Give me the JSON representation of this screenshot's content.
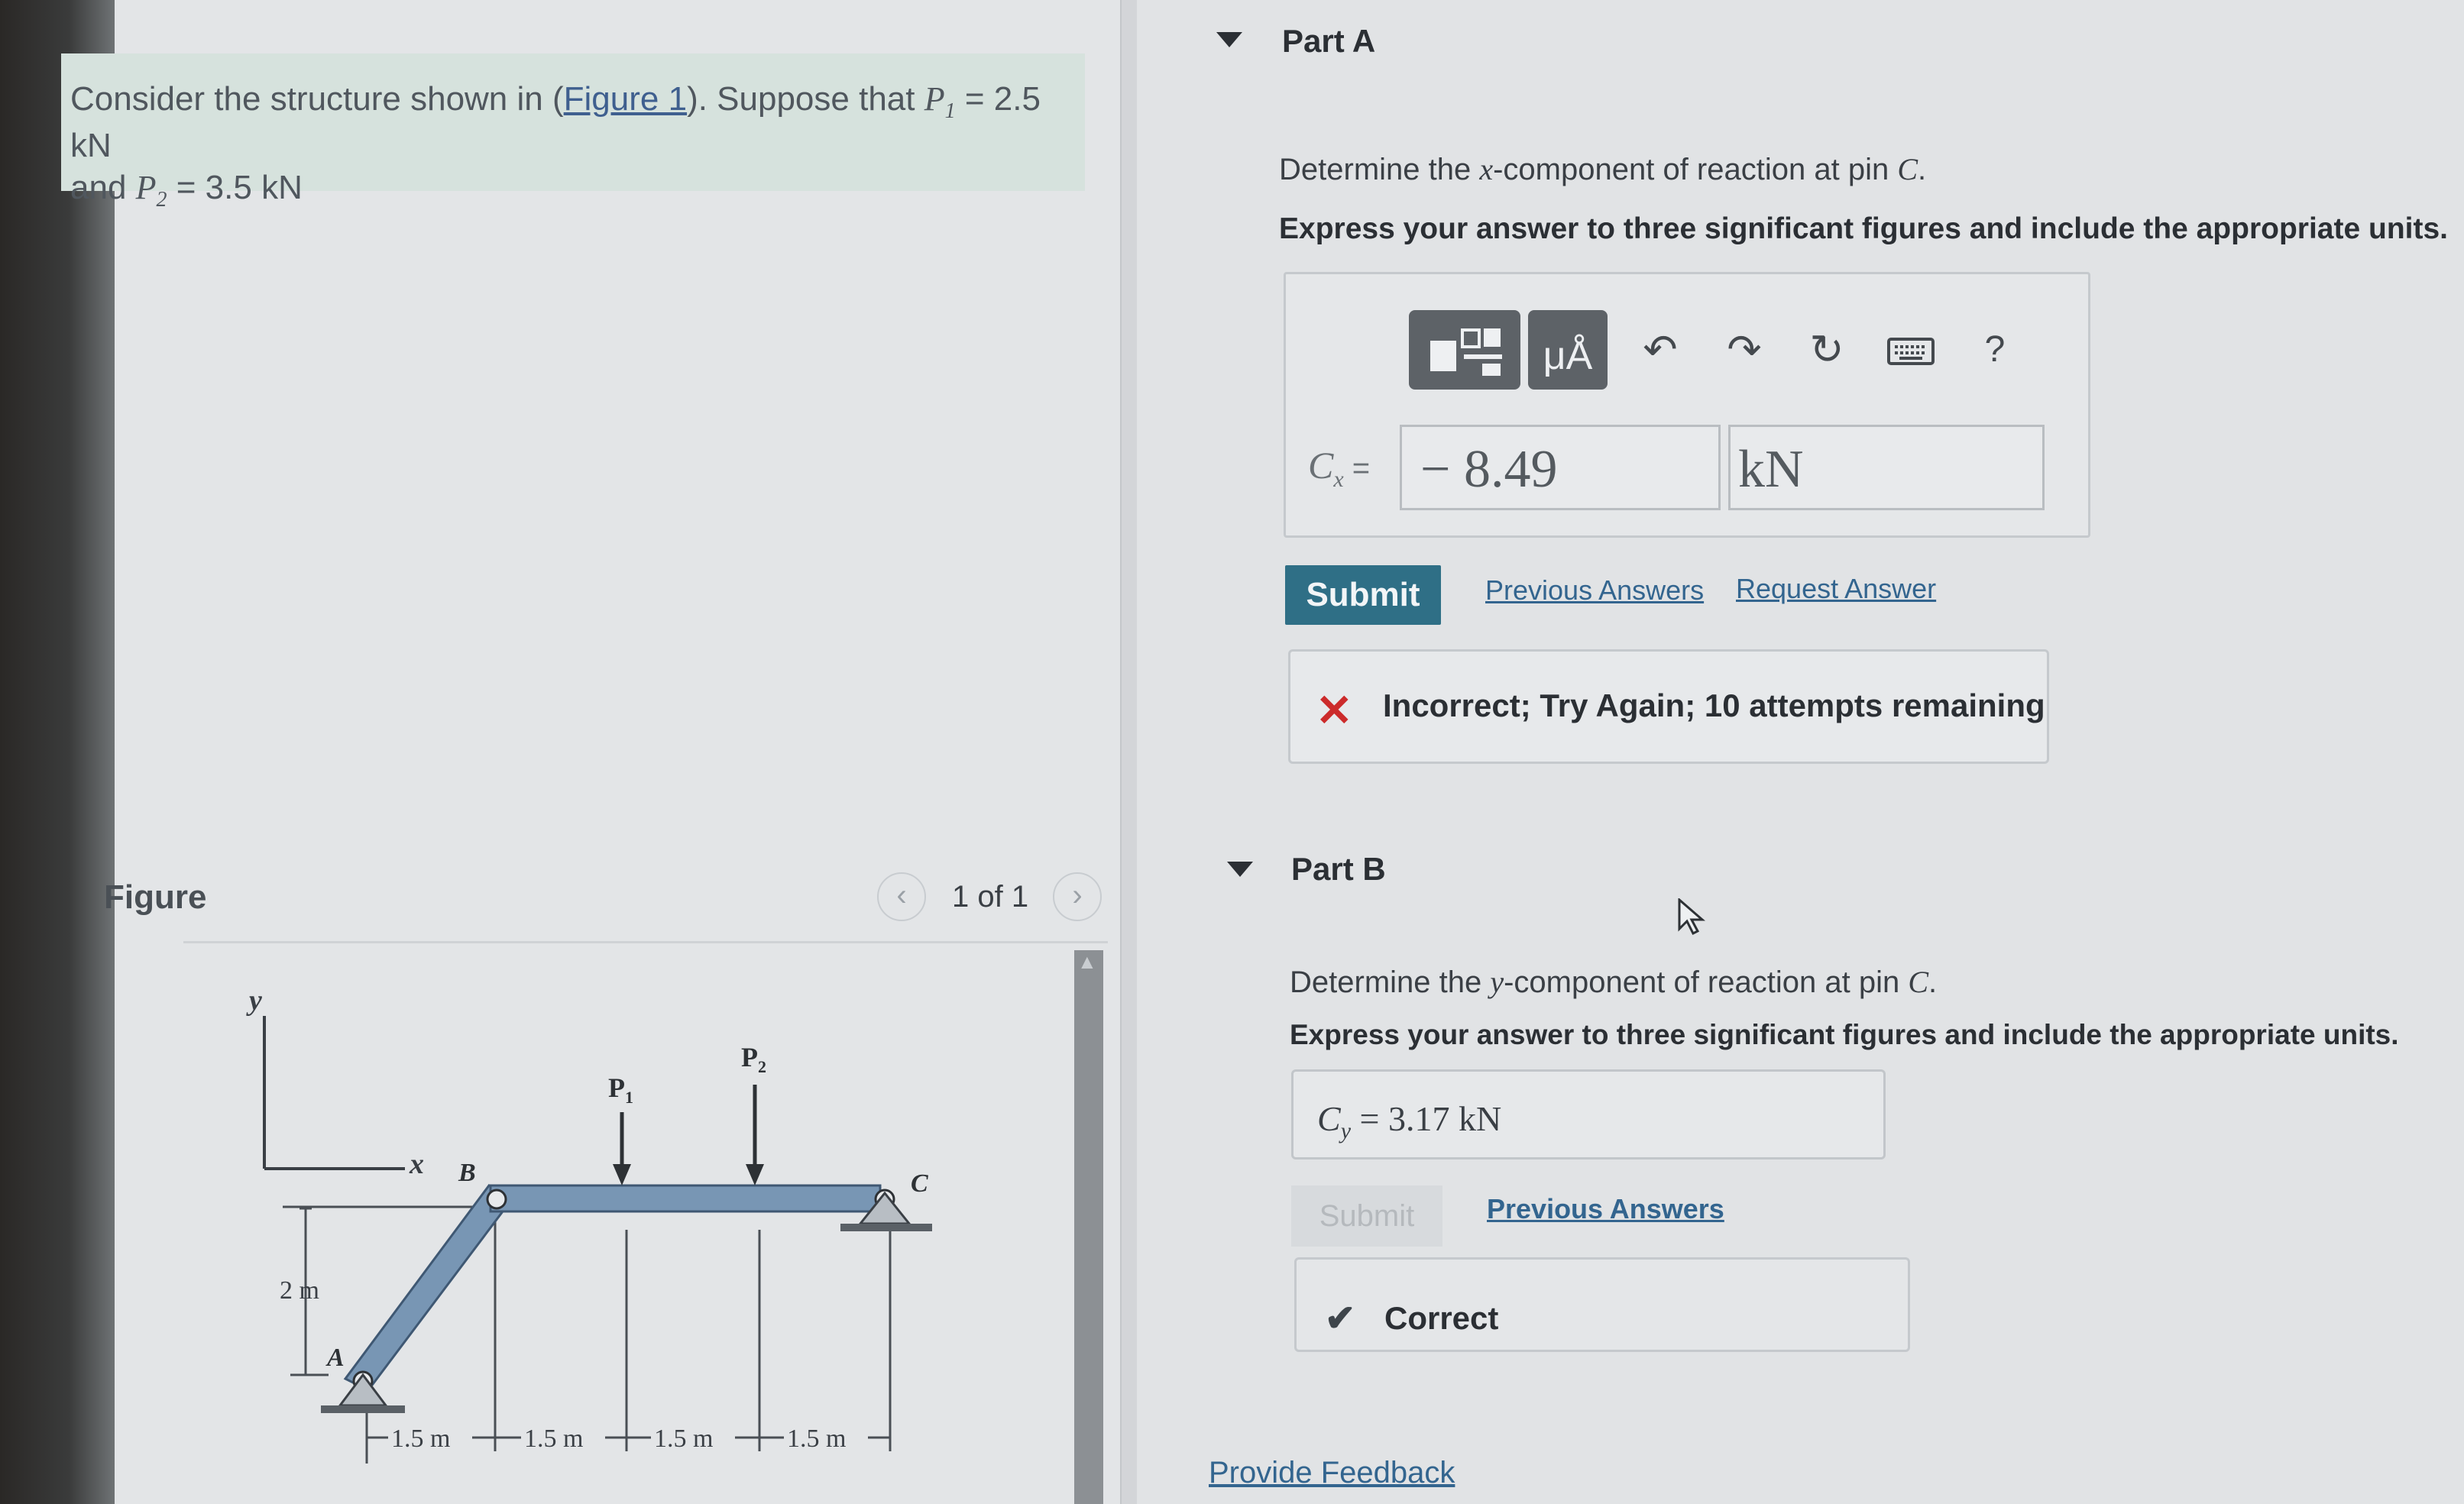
{
  "problem": {
    "text_before_link": "Consider the structure shown in (",
    "figure_link": "Figure 1",
    "text_after_link": "). Suppose that ",
    "p1_sym": "P",
    "p1_sub": "1",
    "p1_val": " = 2.5 kN",
    "and": "and ",
    "p2_sym": "P",
    "p2_sub": "2",
    "p2_val": " = 3.5 kN"
  },
  "figure": {
    "title": "Figure",
    "counter": "1 of 1",
    "prev_icon": "chevron-left-icon",
    "next_icon": "chevron-right-icon",
    "labels": {
      "y": "y",
      "x": "x",
      "B": "B",
      "A": "A",
      "C": "C",
      "P1": "P",
      "P1_sub": "1",
      "P2": "P",
      "P2_sub": "2",
      "height": "2 m",
      "d1": "1.5 m",
      "d2": "1.5 m",
      "d3": "1.5 m",
      "d4": "1.5 m"
    }
  },
  "partA": {
    "title": "Part A",
    "prompt_before": "Determine the ",
    "prompt_var": "x",
    "prompt_after": "-component of reaction at pin ",
    "prompt_pin": "C",
    "prompt_end": ".",
    "instruction": "Express your answer to three significant figures and include the appropriate units.",
    "toolbar": {
      "units_label": "μÅ",
      "help": "?"
    },
    "answer_label": "C",
    "answer_label_sub": "x",
    "answer_eq": " =",
    "answer_value": "− 8.49",
    "answer_unit": "kN",
    "submit": "Submit",
    "previous_answers": "Previous Answers",
    "request_answer": "Request Answer",
    "feedback": "Incorrect; Try Again; 10 attempts remaining"
  },
  "partB": {
    "title": "Part B",
    "prompt_before": "Determine the ",
    "prompt_var": "y",
    "prompt_after": "-component of reaction at pin ",
    "prompt_pin": "C",
    "prompt_end": ".",
    "instruction": "Express your answer to three significant figures and include the appropriate units.",
    "answer_label": "C",
    "answer_label_sub": "y",
    "answer_rest": " = 3.17 kN",
    "submit": "Submit",
    "previous_answers": "Previous Answers",
    "feedback": "Correct"
  },
  "provide_feedback": "Provide Feedback",
  "colors": {
    "submit_bg": "#2f6f86",
    "incorrect": "#cc2b2b",
    "link": "#33658f",
    "member": "#7896b4"
  }
}
